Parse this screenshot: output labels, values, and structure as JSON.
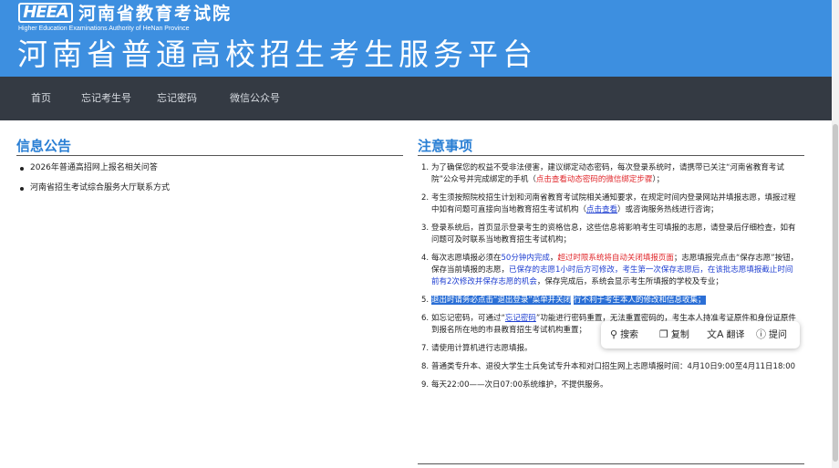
{
  "header": {
    "logo_text": "HEEA",
    "org_name": "河南省教育考试院",
    "org_name_en": "Higher Education Examinations Authority of HeNan Province",
    "platform_title": "河南省普通高校招生考生服务平台"
  },
  "nav": {
    "items": [
      {
        "label": "首页"
      },
      {
        "label": "忘记考生号"
      },
      {
        "label": "忘记密码"
      },
      {
        "label": "微信公众号"
      }
    ]
  },
  "announcements": {
    "title": "信息公告",
    "items": [
      {
        "label": "2026年普通高招网上报名相关问答"
      },
      {
        "label": "河南省招生考试综合服务大厅联系方式"
      }
    ]
  },
  "notes": {
    "title": "注意事项",
    "items": [
      {
        "num": "1.",
        "parts": [
          {
            "text": "为了确保您的权益不受非法侵害，建议绑定动态密码，每次登录系统时，请携带已关注“河南省教育考试院”公众号并完成绑定的手机（"
          },
          {
            "text": "点击查看动态密码的微信绑定步骤",
            "style": "red"
          },
          {
            "text": "）；"
          }
        ]
      },
      {
        "num": "2.",
        "parts": [
          {
            "text": "考生须按照院校招生计划和河南省教育考试院相关通知要求，在规定时间内登录网站并填报志愿，填报过程中如有问题可直接向当地教育招生考试机构（"
          },
          {
            "text": "点击查看",
            "style": "link"
          },
          {
            "text": "）或咨询服务热线进行咨询；"
          }
        ]
      },
      {
        "num": "3.",
        "parts": [
          {
            "text": "登录系统后，首页显示登录考生的资格信息，这些信息将影响考生可填报的志愿，请登录后仔细检查，如有问题可及时联系当地教育招生考试机构；"
          }
        ]
      },
      {
        "num": "4.",
        "parts": [
          {
            "text": "每次志愿填报必须在"
          },
          {
            "text": "50分钟内完成",
            "style": "blue"
          },
          {
            "text": "，"
          },
          {
            "text": "超过时限系统将自动关闭填报页面",
            "style": "red"
          },
          {
            "text": "；志愿填报完点击“保存志愿”按钮，保存当前填报的志愿，"
          },
          {
            "text": "已保存的志愿1小时后方可修改，考生第一次保存志愿后，在该批志愿填报截止时间前有2次修改并保存志愿的机会",
            "style": "blue"
          },
          {
            "text": "，保存完成后，系统会显示考生所填报的学校及专业；"
          }
        ]
      },
      {
        "num": "5.",
        "parts": [
          {
            "text": "退出时请务必点击“退出登录”菜单并关闭",
            "style": "sel"
          },
          {
            "text": "                                                "
          },
          {
            "text": "行不利于考生本人的修改和信息收集；",
            "style": "sel"
          }
        ]
      },
      {
        "num": "6.",
        "parts": [
          {
            "text": "如忘记密码，可通过“"
          },
          {
            "text": "忘记密码",
            "style": "link"
          },
          {
            "text": "”功能进行密码重置，无法重置密码的，考生本人持准考证原件和身份证原件到报名所在地的市县教育招生考试机构重置；"
          }
        ]
      },
      {
        "num": "7.",
        "parts": [
          {
            "text": "请使用计算机进行志愿填报。"
          }
        ]
      },
      {
        "num": "8.",
        "parts": [
          {
            "text": "普通类专升本、退役大学生士兵免试专升本和对口招生网上志愿填报时间：4月10日9:00至4月11日18:00"
          }
        ]
      },
      {
        "num": "9.",
        "parts": [
          {
            "text": "每天22:00——次日07:00系统维护，不提供服务。"
          }
        ]
      }
    ]
  },
  "selection_popup": {
    "buttons": [
      {
        "label": "搜索",
        "icon": "search-icon",
        "glyph": "⚲"
      },
      {
        "label": "复制",
        "icon": "copy-icon",
        "glyph": "❐"
      },
      {
        "label": "翻译",
        "icon": "translate-icon",
        "glyph": "文A"
      },
      {
        "label": "提问",
        "icon": "ask-icon",
        "glyph": "ⓘ"
      }
    ]
  },
  "colors": {
    "header_bg": "#3d8fe0",
    "nav_bg": "#343a43",
    "section_title": "#2a7fd4",
    "emphasis_red": "#e0262a",
    "emphasis_blue": "#1f3fd1",
    "selection": "#2b6fd6"
  }
}
